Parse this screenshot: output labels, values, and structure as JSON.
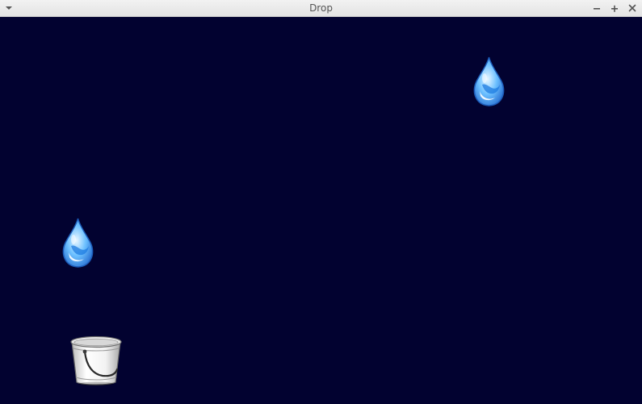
{
  "window": {
    "title": "Drop"
  },
  "icons": {
    "menu": "chevron-down-icon",
    "minimize": "minimize-icon",
    "maximize": "maximize-icon",
    "close": "close-icon"
  },
  "colors": {
    "background": "#020230",
    "drop_light": "#bfe4ff",
    "drop_dark": "#1a6fd0",
    "bucket": "#e6e6e6"
  },
  "sprites": {
    "raindrop": "raindrop-icon",
    "bucket": "bucket-icon"
  }
}
